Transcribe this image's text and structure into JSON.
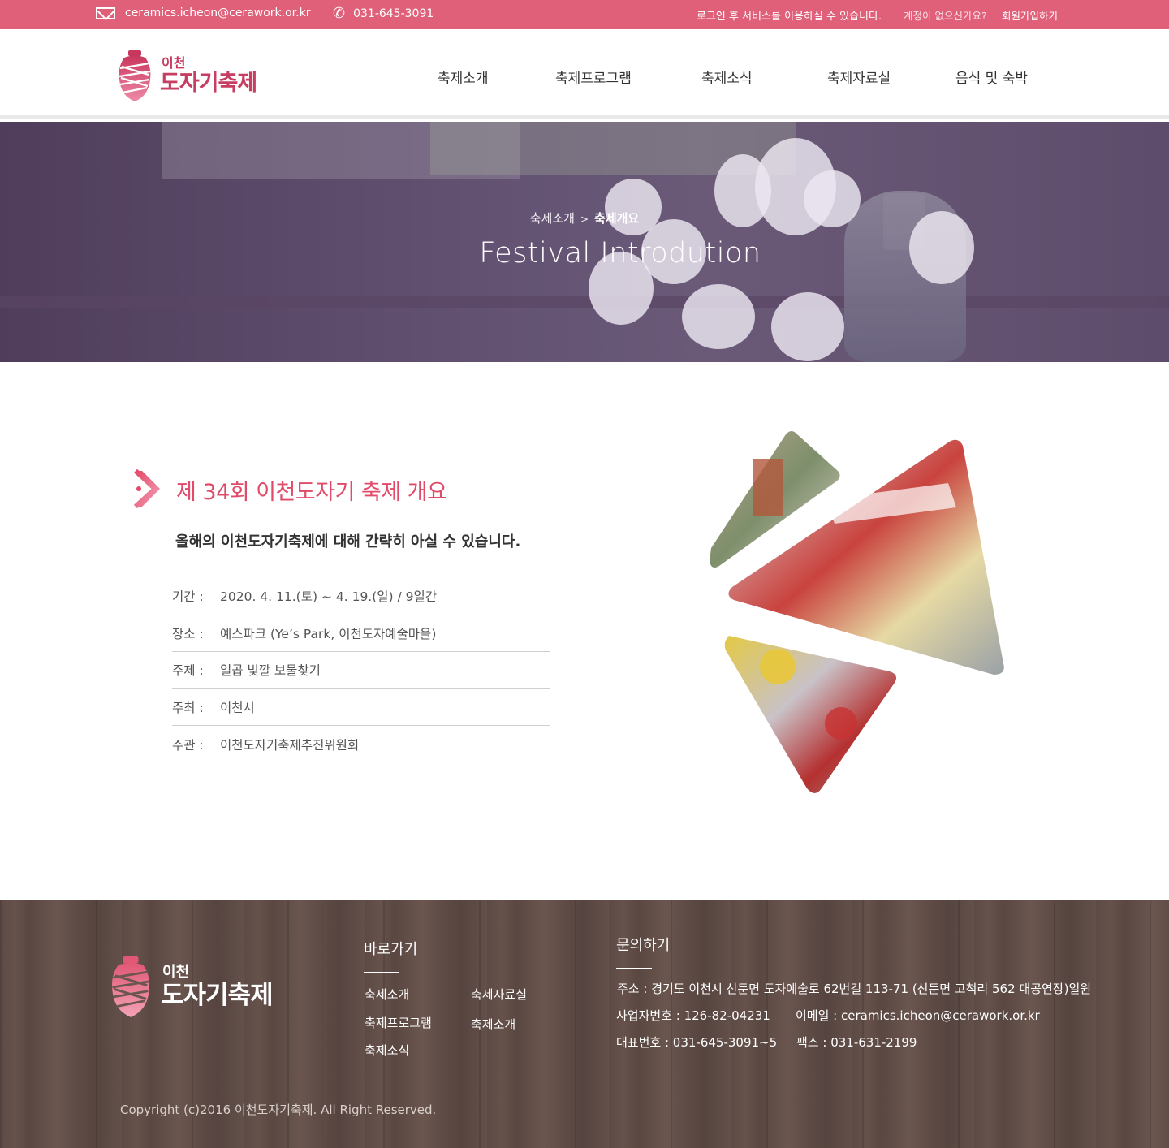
{
  "topbar": {
    "email": "ceramics.icheon@cerawork.or.kr",
    "phone": "031-645-3091",
    "login_message": "로그인 후 서비스를 이용하실 수 있습니다.",
    "no_account": "계정이 없으신가요?",
    "join": "회원가입하기"
  },
  "logo": {
    "small": "이천",
    "big": "도자기축제"
  },
  "nav": [
    "축제소개",
    "축제프로그램",
    "축제소식",
    "축제자료실",
    "음식 및 숙박"
  ],
  "hero": {
    "breadcrumb_parent": "축제소개",
    "breadcrumb_sep": ">",
    "breadcrumb_current": "축제개요",
    "title": "Festival Introdution"
  },
  "section": {
    "title": "제 34회 이천도자기 축제 개요",
    "subtitle": "올해의 이천도자기축제에 대해 간략히 아실 수 있습니다.",
    "info": [
      {
        "key": "기간 :",
        "value": "2020. 4. 11.(토) ~ 4. 19.(일) / 9일간"
      },
      {
        "key": "장소 :",
        "value": "예스파크 (Ye’s Park, 이천도자예술마을)"
      },
      {
        "key": "주제 :",
        "value": "일곱 빛깔 보물찾기"
      },
      {
        "key": "주최 :",
        "value": "이천시"
      },
      {
        "key": "주관 :",
        "value": "이천도자기축제추진위원회"
      }
    ]
  },
  "footer": {
    "logo_small": "이천",
    "logo_big": "도자기축제",
    "quick_title": "바로가기",
    "quick_links": [
      "축제소개",
      "축제프로그램",
      "축제소식",
      "축제자료실",
      "축제소개"
    ],
    "contact_title": "문의하기",
    "address": "주소 : 경기도 이천시 신둔면 도자예술로 62번길 113-71 (신둔면 고척리 562 대공연장)일원",
    "business_no": "사업자번호 : 126-82-04231",
    "email": "이메일 : ceramics.icheon@cerawork.or.kr",
    "tel": "대표번호 : 031-645-3091~5",
    "fax": "팩스 : 031-631-2199",
    "copyright": "Copyright (c)2016 이천도자기축제. All Right Reserved."
  },
  "colors": {
    "brand_pink": "#e0607a",
    "title_pink": "#e04b6a",
    "logo_red": "#c73e63",
    "hero_purple": "#625171",
    "footer_wood": "#5f4b45"
  },
  "icons": [
    "mail-icon",
    "phone-icon",
    "jar-logo-icon",
    "chevron-right-icon"
  ]
}
